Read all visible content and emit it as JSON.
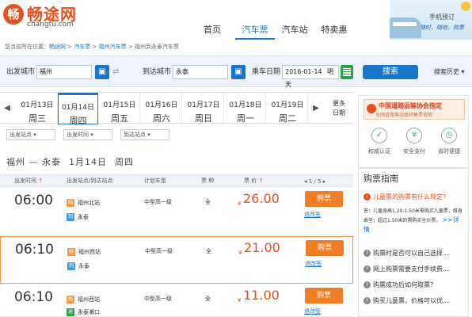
{
  "header": {
    "logo_mark": "畅",
    "logo_text": "畅途网",
    "logo_sub": "changtu.com",
    "nav": [
      "首页",
      "汽车票",
      "汽车站",
      "特卖惠"
    ],
    "active_nav": 1,
    "promo_line1": "手机预订",
    "promo_line2": "随时，随地，购票"
  },
  "breadcrumb": {
    "prefix": "您当前所在位置：",
    "items": [
      "畅途网",
      "汽车票",
      "福州汽车票",
      "福州到永泰汽车票"
    ],
    "sep": " > "
  },
  "search": {
    "from_label": "出发城市",
    "from_value": "福州",
    "to_label": "到达城市",
    "to_value": "永泰",
    "date_label": "乘车日期",
    "date_value": "2016-01-14",
    "date_day": "明天",
    "submit": "搜索",
    "history": "搜索历史 ▾"
  },
  "dates": [
    {
      "d": "01月13日",
      "w": "周三"
    },
    {
      "d": "01月14日",
      "w": "周四"
    },
    {
      "d": "01月15日",
      "w": "周五"
    },
    {
      "d": "01月16日",
      "w": "周六"
    },
    {
      "d": "01月17日",
      "w": "周日"
    },
    {
      "d": "01月18日",
      "w": "周一"
    },
    {
      "d": "01月19日",
      "w": "周二"
    }
  ],
  "active_date": 1,
  "more_dates": [
    "更多",
    "日期"
  ],
  "filters": [
    "出发站点",
    "出发时间",
    "到达站点"
  ],
  "route_title": {
    "route": "福州 — 永泰",
    "date": "1月14日",
    "weekday": "周四"
  },
  "table_header": {
    "depart_time": "出发时间",
    "stations": "出发站点/到达站点",
    "vehicle": "计划车型",
    "ticket_type": "票 种",
    "price": "票 价",
    "pager": "1 / 5"
  },
  "rows": [
    {
      "time": "06:00",
      "from": "福州北站",
      "to": "永泰",
      "to_tag": "到",
      "vehicle": "中型高一级",
      "type": "全",
      "currency": "¥",
      "price": "26.00",
      "buy": "购票",
      "rules": "退改签"
    },
    {
      "time": "06:10",
      "from": "福州西站",
      "to": "永泰",
      "to_tag": "到",
      "vehicle": "中型高一级",
      "type": "全",
      "currency": "¥",
      "price": "21.00",
      "buy": "购票",
      "rules": "退改签"
    },
    {
      "time": "06:10",
      "from": "福州西站",
      "to": "永泰濑口",
      "to_tag": "途",
      "vehicle": "中型高一级",
      "type": "全",
      "currency": "¥",
      "price": "11.00",
      "buy": "购票",
      "rules": "退改签"
    }
  ],
  "from_tag": "始",
  "association": {
    "title": "中国道路运输协会指定",
    "subtitle": "全国道路客运联网售票官网",
    "badges": [
      "权威认证",
      "安全支付",
      "省时便捷"
    ]
  },
  "guide": {
    "title": "购票指南",
    "featured_q": "儿童票的购票有什么规定?",
    "answer": "答：儿童身高1.20-1.50米需购买儿童票，维身乘坐；超过1.50米的需购买全价票，",
    "answer_more": ">>详情",
    "questions": [
      "购票时是否可以自己选择...",
      "网上购票需要支付手续费...",
      "购票成功后如何取票？",
      "购买儿童票，价格可以优..."
    ]
  },
  "colors": {
    "accent": "#1a76c8",
    "orange": "#f07e26",
    "price": "#e8501e"
  }
}
